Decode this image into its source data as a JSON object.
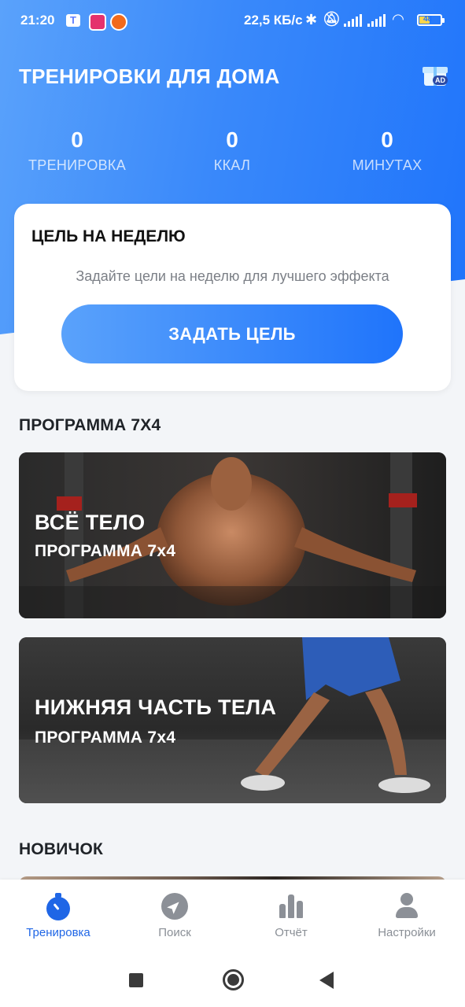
{
  "status_bar": {
    "time": "21:20",
    "speed": "22,5 КБ/с",
    "battery": "48"
  },
  "header": {
    "title": "ТРЕНИРОВКИ ДЛЯ ДОМА",
    "ad_badge": "AD",
    "gradient_start": "#5aa2fb",
    "gradient_end": "#1f74fb"
  },
  "stats": [
    {
      "value": "0",
      "label": "ТРЕНИРОВКА"
    },
    {
      "value": "0",
      "label": "ККАЛ"
    },
    {
      "value": "0",
      "label": "МИНУТАХ"
    }
  ],
  "weekly_goal": {
    "title": "ЦЕЛЬ НА НЕДЕЛЮ",
    "description": "Задайте цели на неделю для лучшего эффекта",
    "button_label": "ЗАДАТЬ ЦЕЛЬ"
  },
  "sections": [
    {
      "title": "ПРОГРАММА 7Х4",
      "programs": [
        {
          "title": "ВСЁ ТЕЛО",
          "subtitle": "ПРОГРАММА 7x4"
        },
        {
          "title": "НИЖНЯЯ ЧАСТЬ ТЕЛА",
          "subtitle": "ПРОГРАММА 7x4"
        }
      ]
    },
    {
      "title": "НОВИЧОК"
    }
  ],
  "bottom_nav": [
    {
      "label": "Тренировка",
      "icon": "stopwatch-icon",
      "active": true
    },
    {
      "label": "Поиск",
      "icon": "compass-icon",
      "active": false
    },
    {
      "label": "Отчёт",
      "icon": "bar-chart-icon",
      "active": false
    },
    {
      "label": "Настройки",
      "icon": "person-icon",
      "active": false
    }
  ],
  "colors": {
    "accent": "#1f66e6",
    "inactive": "#8a8f96",
    "background": "#f3f5f8"
  }
}
